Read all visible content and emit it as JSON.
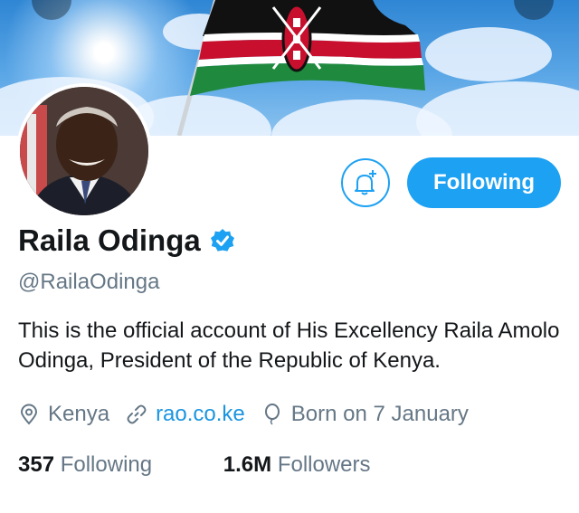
{
  "colors": {
    "accent": "#1da1f2",
    "link": "#1b95e0",
    "text": "#14171a",
    "secondary": "#657786"
  },
  "header": {
    "banner": "kenya-flag-sky-banner"
  },
  "profile": {
    "name": "Raila Odinga",
    "verified": true,
    "handle": "@RailaOdinga",
    "bio": "This is the official account of His Excellency Raila Amolo Odinga, President of the Republic of Kenya.",
    "location": "Kenya",
    "website": "rao.co.ke",
    "birthday": "Born on 7 January"
  },
  "actions": {
    "notifications_icon": "bell-plus-icon",
    "follow_label": "Following"
  },
  "stats": {
    "following_count": "357",
    "following_label": "Following",
    "followers_count": "1.6M",
    "followers_label": "Followers"
  }
}
